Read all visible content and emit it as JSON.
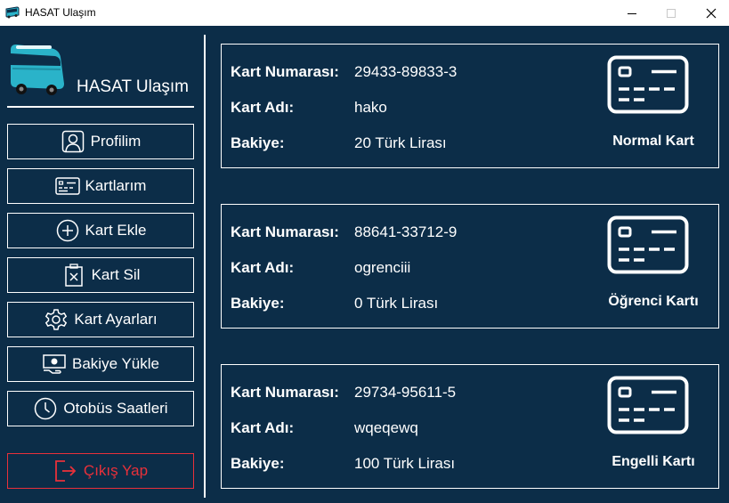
{
  "window": {
    "title": "HASAT Ulaşım"
  },
  "sidebar": {
    "brand": "HASAT Ulaşım",
    "items": [
      {
        "label": "Profilim",
        "icon": "user-profile-icon"
      },
      {
        "label": "Kartlarım",
        "icon": "id-card-icon"
      },
      {
        "label": "Kart Ekle",
        "icon": "plus-circle-icon"
      },
      {
        "label": "Kart Sil",
        "icon": "delete-file-icon"
      },
      {
        "label": "Kart Ayarları",
        "icon": "gear-icon"
      },
      {
        "label": "Bakiye Yükle",
        "icon": "money-icon"
      },
      {
        "label": "Otobüs Saatleri",
        "icon": "clock-icon"
      }
    ],
    "exit": {
      "label": "Çıkış Yap",
      "icon": "logout-icon"
    }
  },
  "labels": {
    "number": "Kart Numarası:",
    "name": "Kart Adı:",
    "balance": "Bakiye:"
  },
  "cards": [
    {
      "number": "29433-89833-3",
      "name": "hako",
      "balance": "20 Türk Lirası",
      "type": "Normal Kart"
    },
    {
      "number": "88641-33712-9",
      "name": "ogrenciii",
      "balance": "0 Türk Lirası",
      "type": "Öğrenci Kartı"
    },
    {
      "number": "29734-95611-5",
      "name": "wqeqewq",
      "balance": "100 Türk Lirası",
      "type": "Engelli Kartı"
    }
  ],
  "colors": {
    "background": "#0c2d48",
    "foreground": "#ffffff",
    "exit": "#e8303a",
    "bus": "#2ab3c9"
  }
}
